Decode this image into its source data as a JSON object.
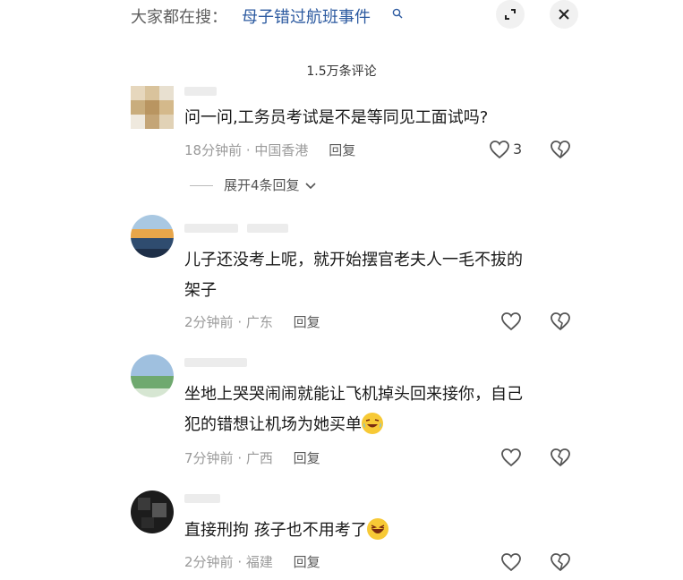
{
  "search": {
    "prefix": "大家都在搜：",
    "query": "母子错过航班事件"
  },
  "comments_count": "1.5万条评论",
  "comments": [
    {
      "text": "问一问,工务员考试是不是等同见工面试吗?",
      "time": "18分钟前",
      "location": "中国香港",
      "reply": "回复",
      "likes": "3",
      "expand": "展开4条回复"
    },
    {
      "line1": "儿子还没考上呢，就开始摆官老夫人一毛不拔的",
      "line2": "架子",
      "time": "2分钟前",
      "location": "广东",
      "reply": "回复"
    },
    {
      "line1": "坐地上哭哭闹闹就能让飞机掉头回来接你，自己",
      "line2": "犯的错想让机场为她买单",
      "time": "7分钟前",
      "location": "广西",
      "reply": "回复"
    },
    {
      "text": "直接刑拘 孩子也不用考了",
      "time": "2分钟前",
      "location": "福建",
      "reply": "回复"
    }
  ],
  "icons": {
    "like": "heart-icon",
    "dislike": "broken-heart-icon",
    "expand": "chevron-down-icon",
    "search": "search-icon",
    "fullscreen": "expand-icon",
    "close": "close-icon"
  }
}
